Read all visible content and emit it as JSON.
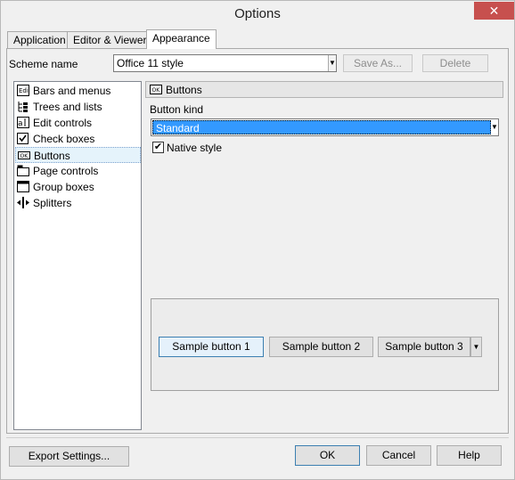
{
  "window": {
    "title": "Options",
    "close_glyph": "✕"
  },
  "tabs": [
    {
      "label": "Application"
    },
    {
      "label": "Editor & Viewers"
    },
    {
      "label": "Appearance"
    }
  ],
  "scheme": {
    "label": "Scheme name",
    "value": "Office 11 style",
    "save_as": "Save As...",
    "delete": "Delete"
  },
  "tree": [
    {
      "label": "Bars and menus",
      "icon": "bars-menus-icon"
    },
    {
      "label": "Trees and lists",
      "icon": "tree-list-icon"
    },
    {
      "label": "Edit controls",
      "icon": "edit-control-icon"
    },
    {
      "label": "Check boxes",
      "icon": "checkbox-icon"
    },
    {
      "label": "Buttons",
      "icon": "button-icon"
    },
    {
      "label": "Page controls",
      "icon": "page-control-icon"
    },
    {
      "label": "Group boxes",
      "icon": "group-box-icon"
    },
    {
      "label": "Splitters",
      "icon": "splitter-icon"
    }
  ],
  "panel": {
    "header": "Buttons",
    "button_kind_label": "Button kind",
    "button_kind_value": "Standard",
    "native_style_label": "Native style",
    "native_style_checked": true,
    "samples": [
      "Sample button 1",
      "Sample button 2",
      "Sample button 3"
    ]
  },
  "footer": {
    "export": "Export Settings...",
    "ok": "OK",
    "cancel": "Cancel",
    "help": "Help"
  },
  "colors": {
    "selection": "#3399ff",
    "close": "#c7504e"
  }
}
